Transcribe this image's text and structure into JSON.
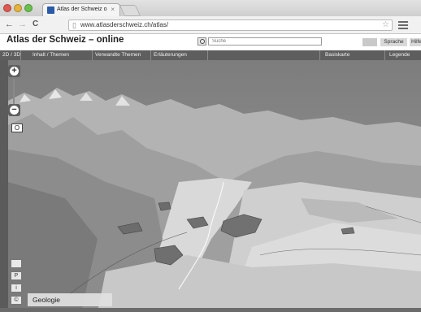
{
  "browser": {
    "tab_title": "Atlas der Schweiz o",
    "tab_close": "×",
    "url": "www.atlasderschweiz.ch/atlas/",
    "back": "←",
    "forward": "→",
    "reload": "C",
    "page_icon": "▯",
    "star": "☆"
  },
  "header": {
    "title": "Atlas der Schweiz – online",
    "search_placeholder": "Suche",
    "language_button": "Sprache",
    "help_button": "Hilfe"
  },
  "menu": [
    {
      "label": "2D / 3D"
    },
    {
      "label": "Inhalt / Themen"
    },
    {
      "label": "Verwandte Themen"
    },
    {
      "label": "Erläuterungen"
    },
    {
      "label": ""
    },
    {
      "label": "Basiskarte"
    },
    {
      "label": "Legende"
    }
  ],
  "controls": {
    "zoom_in": "+",
    "zoom_out": "−",
    "orientation": "O",
    "btn_p": "P",
    "btn_i": "i",
    "btn_copyright": "©"
  },
  "map": {
    "theme_label": "Geologie"
  },
  "colors": {
    "menubar": "#5e5e5e",
    "sky": "#8e8e8e",
    "terrain": "#c4c4c4",
    "geology_patch": "#6f6f6f"
  }
}
